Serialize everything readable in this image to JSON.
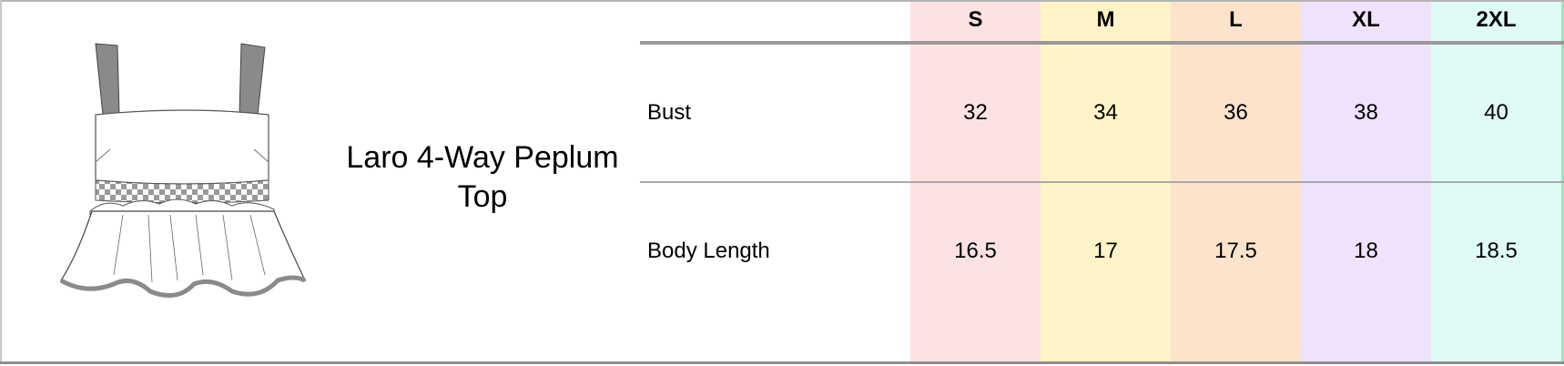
{
  "product": {
    "title": "Laro 4-Way Peplum Top",
    "illustration_icon": "peplum-top-drawing"
  },
  "size_chart": {
    "sizes": [
      {
        "label": "S",
        "color": "#fde2e2"
      },
      {
        "label": "M",
        "color": "#fff3c8"
      },
      {
        "label": "L",
        "color": "#fbe3cc"
      },
      {
        "label": "XL",
        "color": "#efe2fb"
      },
      {
        "label": "2XL",
        "color": "#e0fbf6"
      }
    ],
    "rows": [
      {
        "label": "Bust",
        "values": [
          "32",
          "34",
          "36",
          "38",
          "40"
        ]
      },
      {
        "label": "Body Length",
        "values": [
          "16.5",
          "17",
          "17.5",
          "18",
          "18.5"
        ]
      }
    ]
  }
}
